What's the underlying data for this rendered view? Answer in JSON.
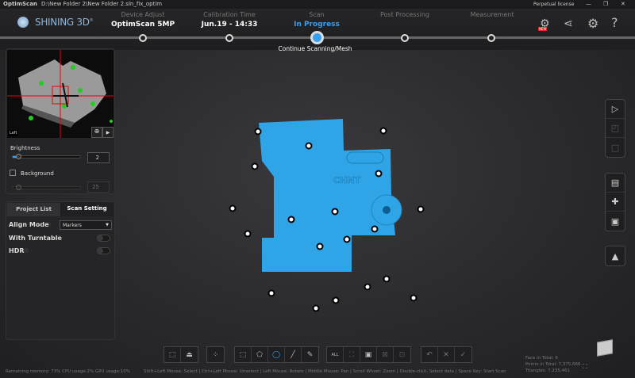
{
  "window": {
    "app": "OptimScan",
    "separator": "-",
    "path": "D:\\New Folder 2\\New Folder 2.sln_fix_optim",
    "license": "Perpetual license",
    "minimize": "—",
    "restore": "❐",
    "close": "✕"
  },
  "brand": {
    "name": "SHINING 3D",
    "reg": "®"
  },
  "steps": [
    {
      "label": "Device Adjust",
      "value": "OptimScan 5MP"
    },
    {
      "label": "Calibration Time",
      "value": "Jun.19 - 14:33"
    },
    {
      "label": "Scan",
      "value": "In Progress",
      "sub": "Continue Scanning/Mesh"
    },
    {
      "label": "Post Processing",
      "value": ""
    },
    {
      "label": "Measurement",
      "value": ""
    }
  ],
  "header_icons": {
    "new_badge": "NEW"
  },
  "camera": {
    "view_label": "Left",
    "brightness_label": "Brightness",
    "brightness_value": "2",
    "brightness_fraction": 0.1,
    "background_label": "Background",
    "background_value": "25",
    "background_checked": false
  },
  "tabs": [
    {
      "label": "Project List",
      "active": false
    },
    {
      "label": "Scan Setting",
      "active": true
    }
  ],
  "settings": {
    "align_mode_label": "Align Mode",
    "align_mode_value": "Markers",
    "turntable_label": "With Turntable",
    "turntable_on": false,
    "hdr_label": "HDR",
    "hdr_on": false
  },
  "stats": {
    "faces": "Face in Total: 6",
    "points": "Points in Total: 7,375,666",
    "triangles": "Triangles: 7,235,461"
  },
  "status": {
    "resources": "Remaining memory: 73% CPU usage:2%  GPU usage:10%",
    "hints": "Shift+Left Mouse: Select | Ctrl+Left Mouse: Unselect | Left Mouse: Rotate | Middle Mouse: Pan | Scroll Wheel: Zoom | Double-click: Select data | Space Key: Start Scan"
  },
  "toolbar": {
    "select_all": "ALL"
  },
  "colors": {
    "accent": "#3aa0f0",
    "mesh": "#2fa4e6",
    "active_step": "#3a9ff0"
  }
}
